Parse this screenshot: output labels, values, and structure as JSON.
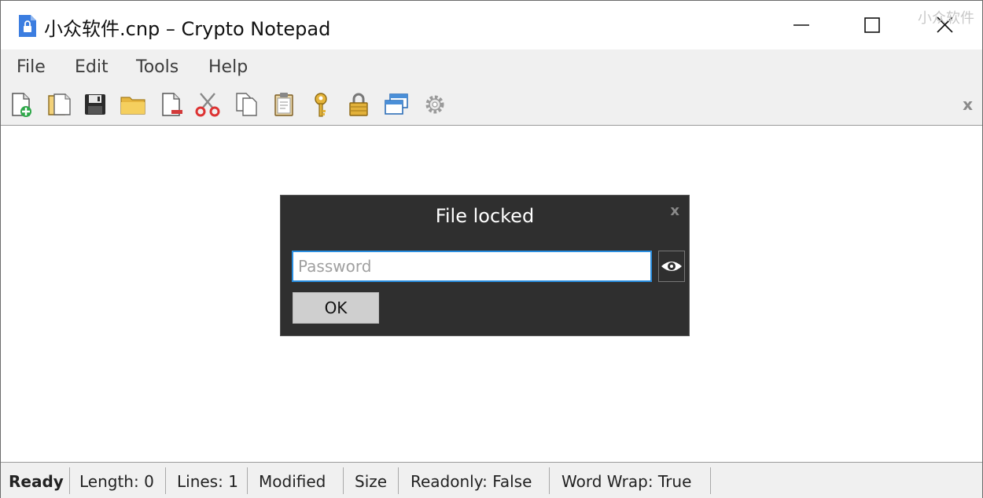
{
  "window": {
    "title": "小众软件.cnp – Crypto Notepad",
    "watermark": "小众软件"
  },
  "menu": {
    "items": [
      "File",
      "Edit",
      "Tools",
      "Help"
    ]
  },
  "toolbar": {
    "icons": [
      "new-file-icon",
      "open-files-icon",
      "save-icon",
      "folder-icon",
      "delete-file-icon",
      "cut-icon",
      "copy-icon",
      "paste-icon",
      "key-icon",
      "lock-icon",
      "windows-icon",
      "settings-gear-icon"
    ],
    "close_label": "x"
  },
  "dialog": {
    "title": "File locked",
    "close_label": "x",
    "password_placeholder": "Password",
    "password_value": "",
    "ok_label": "OK"
  },
  "status": {
    "ready": "Ready",
    "length": "Length: 0",
    "lines": "Lines: 1",
    "modified": "Modified",
    "size": "Size",
    "readonly": "Readonly: False",
    "wordwrap": "Word Wrap: True"
  },
  "colors": {
    "accent": "#2a8ee0",
    "dialog_bg": "#2f2f2f",
    "bar_bg": "#f0f0f0"
  }
}
